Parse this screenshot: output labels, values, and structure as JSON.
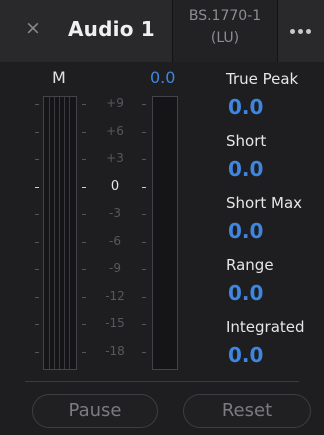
{
  "header": {
    "close_glyph": "×",
    "title": "Audio 1",
    "standard_line1": "BS.1770-1",
    "standard_line2": "(LU)"
  },
  "meter": {
    "channel_label": "M",
    "current_value": "0.0",
    "scale": [
      "+9",
      "+6",
      "+3",
      "0",
      "-3",
      "-6",
      "-9",
      "-12",
      "-15",
      "-18"
    ]
  },
  "readings": [
    {
      "label": "True Peak",
      "value": "0.0"
    },
    {
      "label": "Short",
      "value": "0.0"
    },
    {
      "label": "Short Max",
      "value": "0.0"
    },
    {
      "label": "Range",
      "value": "0.0"
    },
    {
      "label": "Integrated",
      "value": "0.0"
    }
  ],
  "footer": {
    "pause_label": "Pause",
    "reset_label": "Reset"
  },
  "colors": {
    "accent": "#3e86e0",
    "background": "#1e1e21"
  }
}
